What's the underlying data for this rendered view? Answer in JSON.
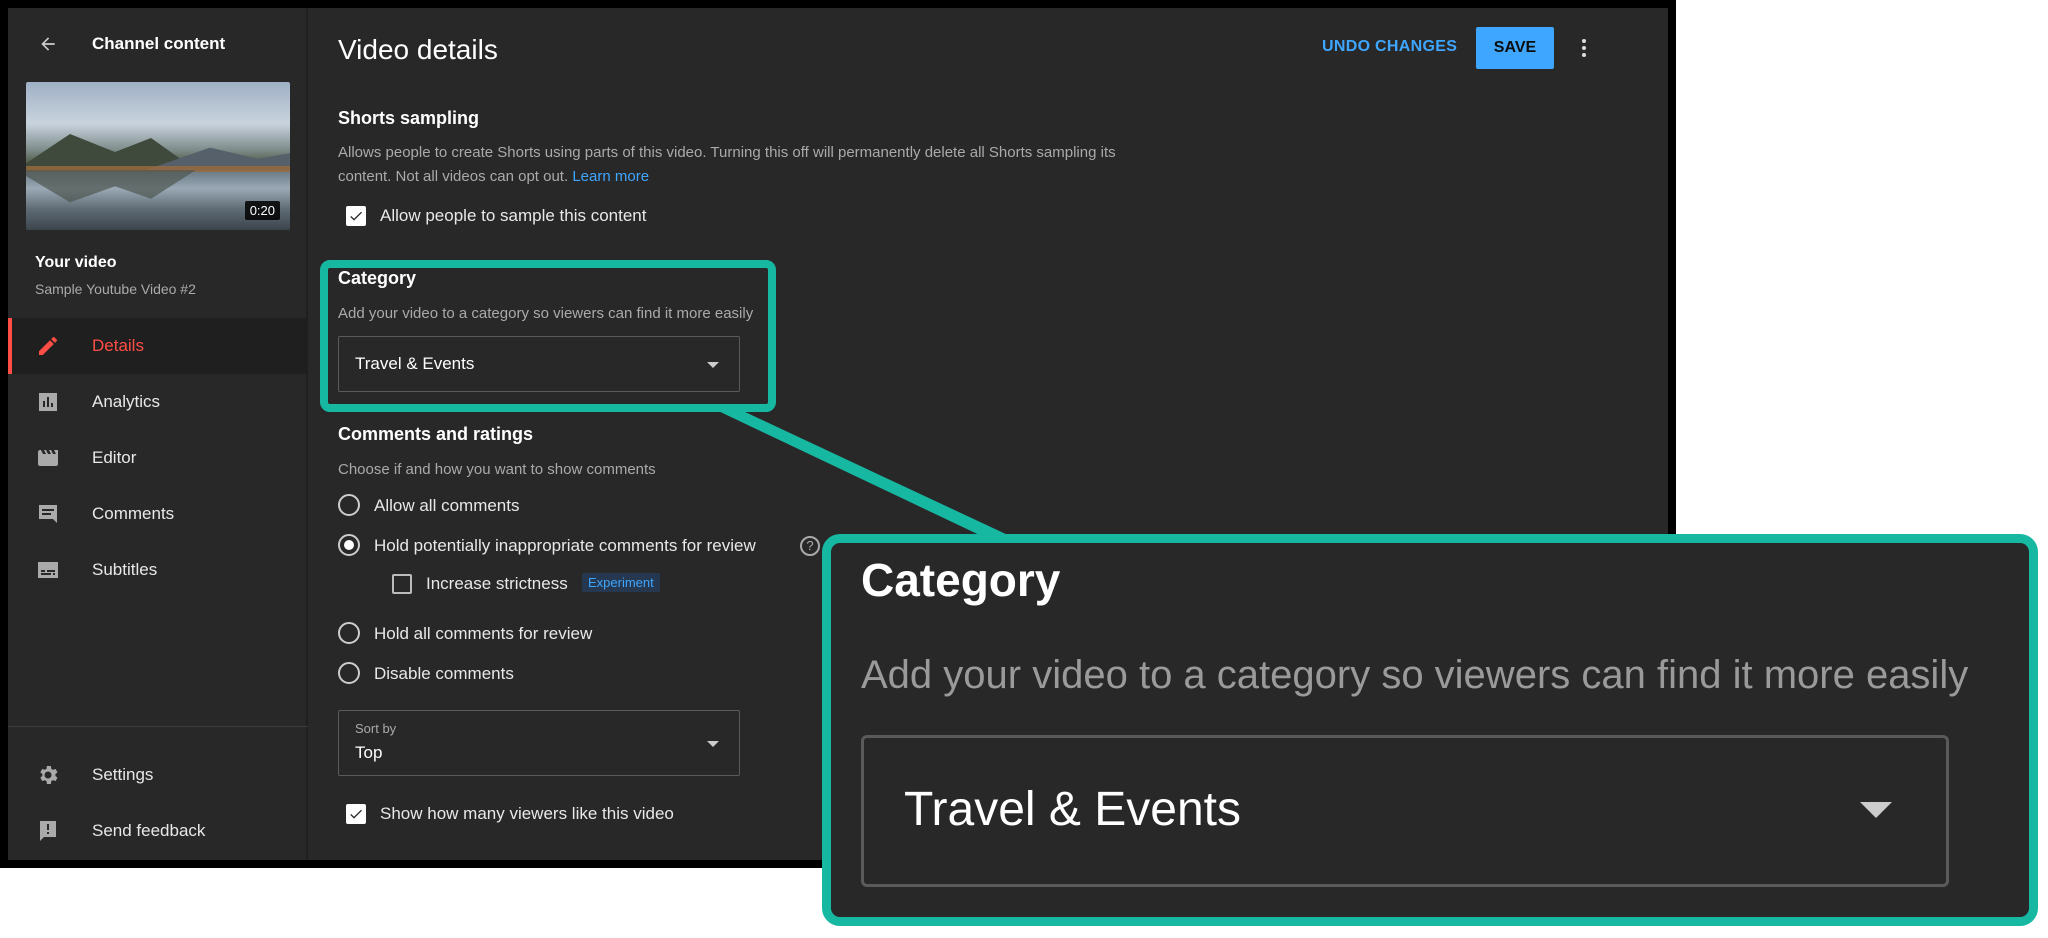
{
  "sidebar": {
    "header_title": "Channel content",
    "video_duration": "0:20",
    "your_video_label": "Your video",
    "video_title": "Sample Youtube Video #2",
    "nav": [
      {
        "label": "Details",
        "icon": "pencil-icon",
        "active": true
      },
      {
        "label": "Analytics",
        "icon": "analytics-icon"
      },
      {
        "label": "Editor",
        "icon": "clapper-icon"
      },
      {
        "label": "Comments",
        "icon": "comment-icon"
      },
      {
        "label": "Subtitles",
        "icon": "subtitles-icon"
      }
    ],
    "footer": [
      {
        "label": "Settings",
        "icon": "gear-icon"
      },
      {
        "label": "Send feedback",
        "icon": "feedback-icon"
      }
    ]
  },
  "header": {
    "title": "Video details",
    "undo_label": "UNDO CHANGES",
    "save_label": "SAVE"
  },
  "shorts": {
    "title": "Shorts sampling",
    "description_line1": "Allows people to create Shorts using parts of this video. Turning this off will permanently delete all Shorts sampling its",
    "description_line2": "content. Not all videos can opt out.",
    "learn_more": "Learn more",
    "checkbox_label": "Allow people to sample this content"
  },
  "category": {
    "title": "Category",
    "description": "Add your video to a category so viewers can find it more easily",
    "selected": "Travel & Events"
  },
  "comments": {
    "title": "Comments and ratings",
    "description": "Choose if and how you want to show comments",
    "options": [
      "Allow all comments",
      "Hold potentially inappropriate comments for review",
      "Hold all comments for review",
      "Disable comments"
    ],
    "selected_index": 1,
    "help_glyph": "?",
    "strictness_label": "Increase strictness",
    "experiment_badge": "Experiment",
    "sort_by_label": "Sort by",
    "sort_by_value": "Top",
    "show_likes_label": "Show how many viewers like this video"
  },
  "colors": {
    "accent_blue": "#3ea6ff",
    "active_red": "#ff4e45",
    "highlight_teal": "#16b8a2"
  }
}
